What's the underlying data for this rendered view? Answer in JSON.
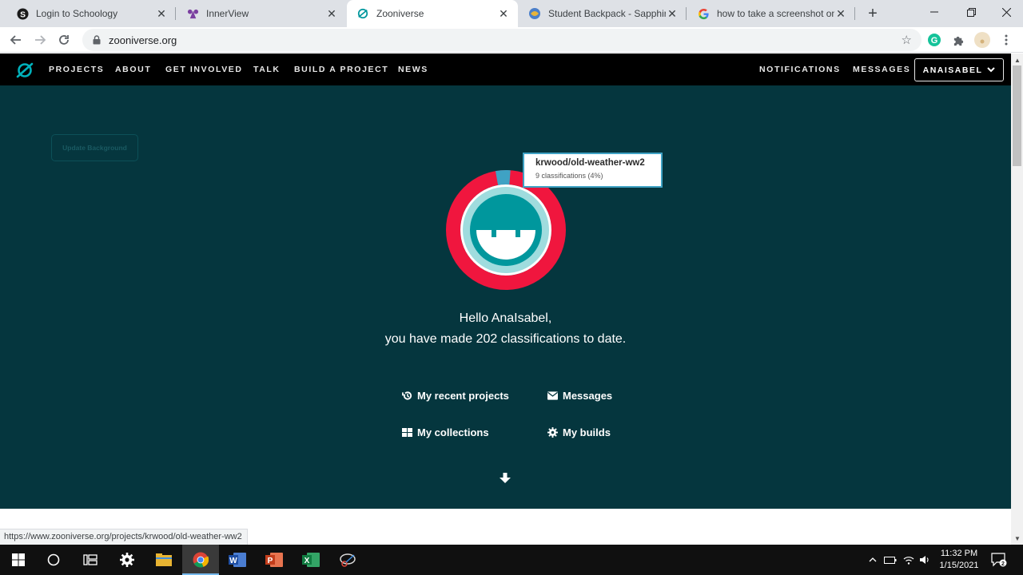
{
  "browser": {
    "tabs": [
      {
        "title": "Login to Schoology",
        "favicon": "schoology-icon"
      },
      {
        "title": "InnerView",
        "favicon": "innerview-icon"
      },
      {
        "title": "Zooniverse",
        "favicon": "zooniverse-icon",
        "active": true
      },
      {
        "title": "Student Backpack - Sapphire C",
        "favicon": "sapphire-icon"
      },
      {
        "title": "how to take a screenshot on p",
        "favicon": "google-icon"
      }
    ],
    "url": "zooniverse.org",
    "status_url": "https://www.zooniverse.org/projects/krwood/old-weather-ww2"
  },
  "nav": {
    "left_links": [
      "PROJECTS",
      "ABOUT",
      "GET INVOLVED",
      "TALK",
      "BUILD A PROJECT",
      "NEWS"
    ],
    "right_links": [
      "NOTIFICATIONS",
      "MESSAGES"
    ],
    "user": "ANAISABEL"
  },
  "hero": {
    "update_background": "Update Background",
    "tooltip_title": "krwood/old-weather-ww2",
    "tooltip_detail": "9 classifications (4%)",
    "ring_fraction_highlighted": 0.04,
    "greeting_line1": "Hello AnaIsabel,",
    "greeting_line2": "you have made 202 classifications to date.",
    "links": [
      {
        "label": "My recent projects",
        "icon": "history-icon"
      },
      {
        "label": "Messages",
        "icon": "envelope-icon"
      },
      {
        "label": "My collections",
        "icon": "grid-icon"
      },
      {
        "label": "My builds",
        "icon": "gear-icon"
      }
    ]
  },
  "taskbar": {
    "time": "11:32 PM",
    "date": "1/15/2021",
    "notification_count": "2"
  },
  "colors": {
    "nav_bg": "#000000",
    "hero_bg": "#05363e",
    "ring_main": "#f0163e",
    "ring_highlight": "#3fa2c4",
    "avatar_teal": "#00979d"
  }
}
